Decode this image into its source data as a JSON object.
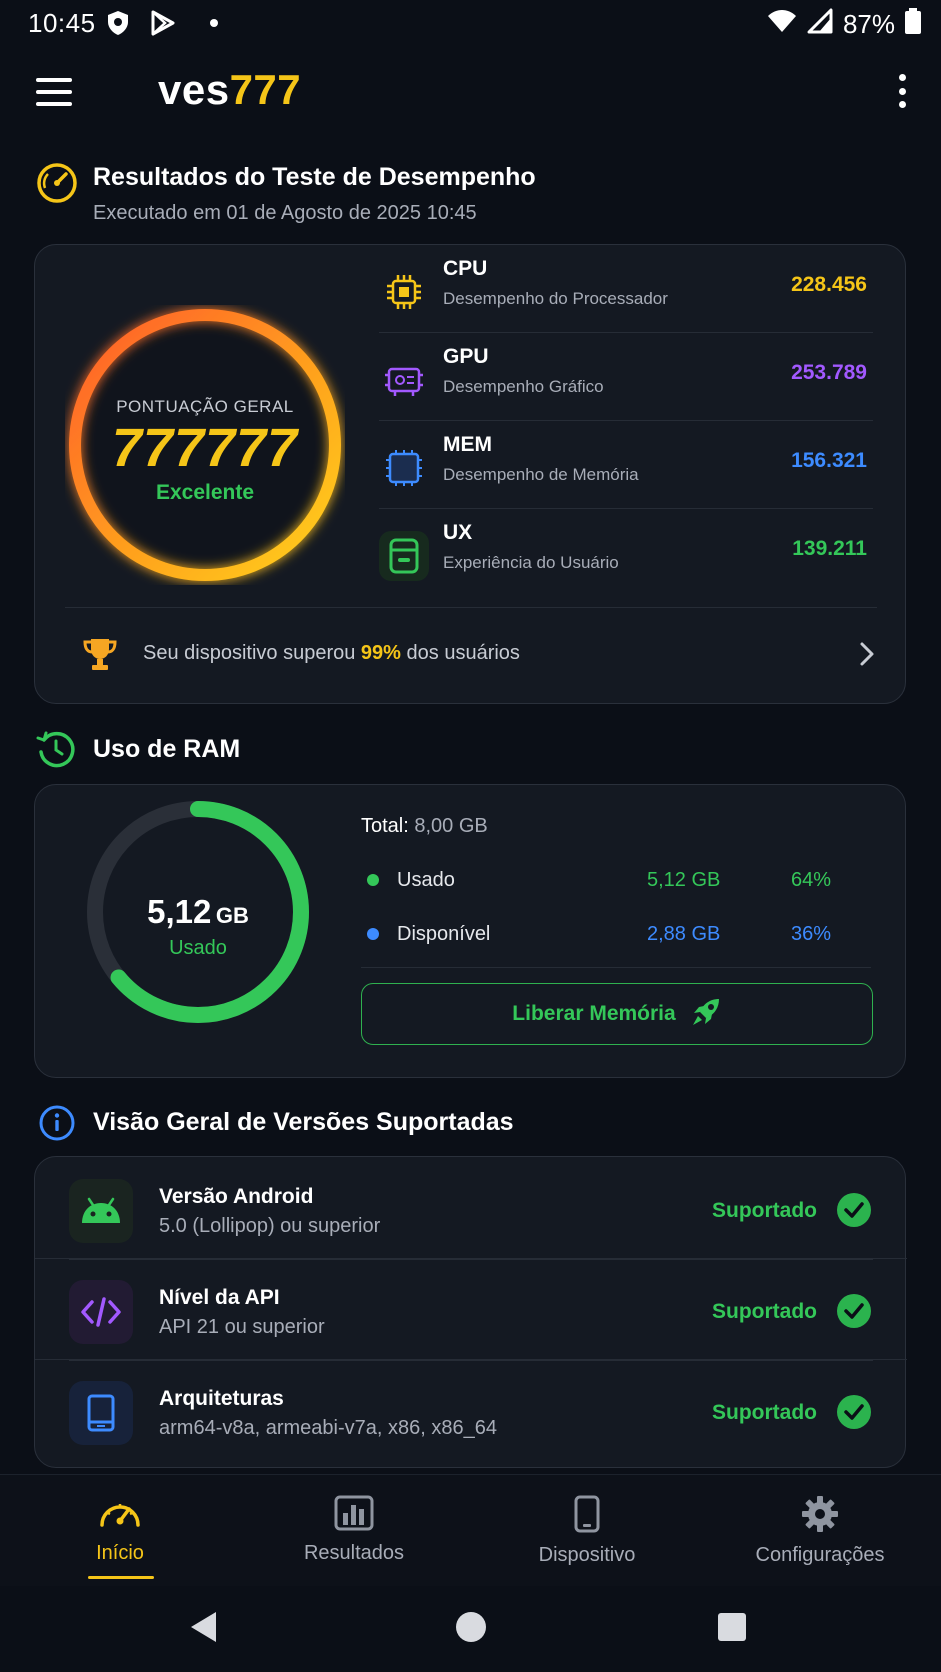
{
  "status_bar": {
    "time": "10:45",
    "battery": "87%"
  },
  "app": {
    "logo_part1": "ves",
    "logo_part2": "777"
  },
  "performance": {
    "title": "Resultados do Teste de Desempenho",
    "subtitle": "Executado em 01 de Agosto de 2025 10:45",
    "score_label": "PONTUAÇÃO GERAL",
    "score": "777777",
    "rating": "Excelente",
    "metrics": [
      {
        "name": "CPU",
        "desc": "Desempenho do Processador",
        "value": "228.456",
        "color": "#f5c518",
        "icon": "cpu-icon"
      },
      {
        "name": "GPU",
        "desc": "Desempenho Gráfico",
        "value": "253.789",
        "color": "#a259ff",
        "icon": "gpu-icon"
      },
      {
        "name": "MEM",
        "desc": "Desempenho de Memória",
        "value": "156.321",
        "color": "#3d8bff",
        "icon": "memory-icon"
      },
      {
        "name": "UX",
        "desc": "Experiência do Usuário",
        "value": "139.211",
        "color": "#34c759",
        "icon": "ux-icon"
      }
    ],
    "rank_prefix": "Seu dispositivo superou",
    "rank_percent": "99%",
    "rank_suffix": "dos usuários"
  },
  "ram": {
    "title": "Uso de RAM",
    "used_value": "5,12",
    "used_unit": "GB",
    "used_label": "Usado",
    "used_fraction": 0.64,
    "total_label": "Total:",
    "total_value": "8,00 GB",
    "rows": [
      {
        "label": "Usado",
        "size": "5,12 GB",
        "percent": "64%",
        "color": "#34c759"
      },
      {
        "label": "Disponível",
        "size": "2,88 GB",
        "percent": "36%",
        "color": "#3d8bff"
      }
    ],
    "free_button": "Liberar Memória"
  },
  "versions": {
    "title": "Visão Geral de Versões Suportadas",
    "items": [
      {
        "title": "Versão Android",
        "sub": "5.0 (Lollipop) ou superior",
        "status": "Suportado",
        "icon": "android-icon"
      },
      {
        "title": "Nível da API",
        "sub": "API 21 ou superior",
        "status": "Suportado",
        "icon": "code-icon"
      },
      {
        "title": "Arquiteturas",
        "sub": "arm64-v8a, armeabi-v7a, x86, x86_64",
        "status": "Suportado",
        "icon": "tablet-icon"
      }
    ]
  },
  "nav": {
    "items": [
      {
        "label": "Início",
        "icon": "speedometer-icon",
        "active": true
      },
      {
        "label": "Resultados",
        "icon": "bar-chart-icon",
        "active": false
      },
      {
        "label": "Dispositivo",
        "icon": "phone-icon",
        "active": false
      },
      {
        "label": "Configurações",
        "icon": "gear-icon",
        "active": false
      }
    ]
  },
  "colors": {
    "accent": "#f5c518",
    "success": "#34c759",
    "info": "#3d8bff",
    "purple": "#a259ff",
    "background": "#0b0f17"
  }
}
